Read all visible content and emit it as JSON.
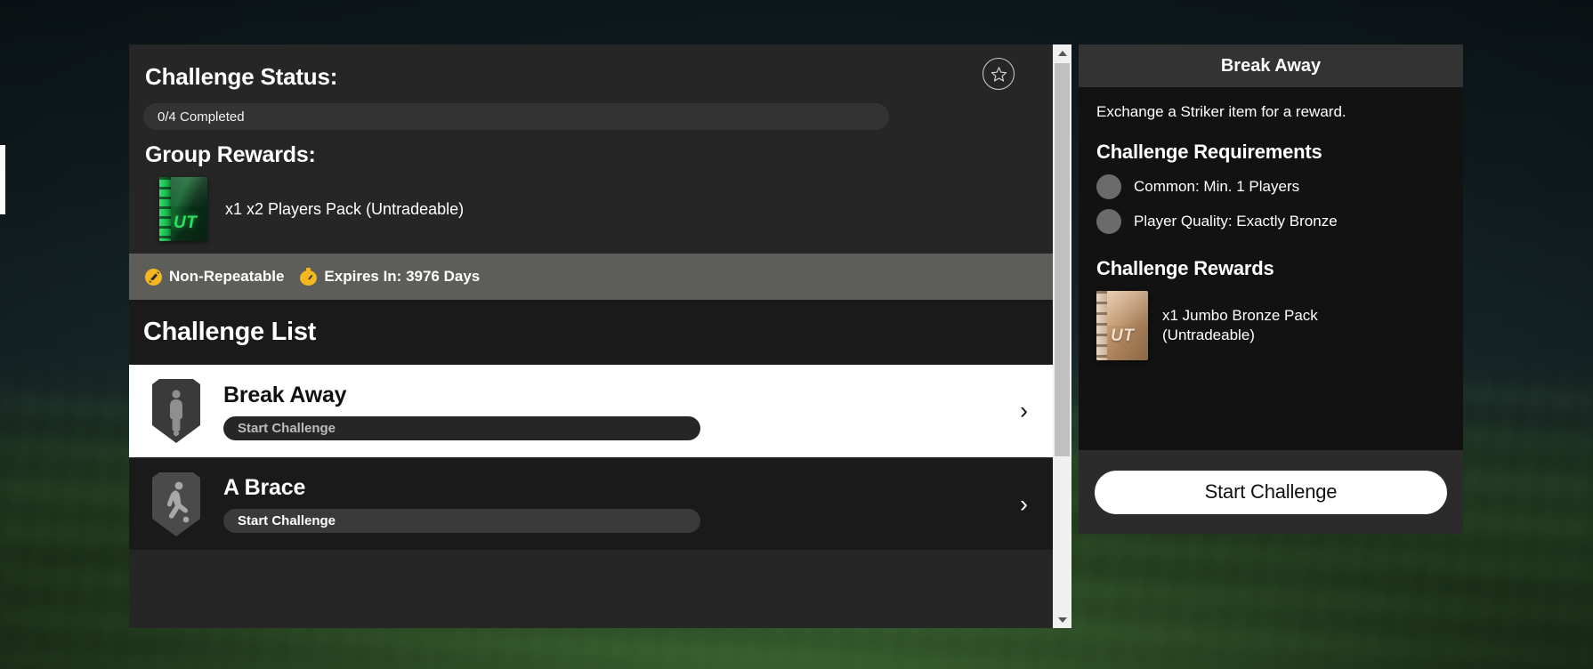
{
  "left_panel": {
    "status_title": "Challenge Status:",
    "status_value": "0/4 Completed",
    "group_rewards_title": "Group Rewards:",
    "group_reward": {
      "icon": "pack-green-ut-icon",
      "label": "x1 x2 Players Pack (Untradeable)",
      "pack_mark": "UT"
    },
    "meta": {
      "repeatable_icon": "no-repeat-icon",
      "repeatable_label": "Non-Repeatable",
      "timer_icon": "stopwatch-icon",
      "expiry_label": "Expires In: 3976 Days"
    },
    "favorite_icon": "star-icon",
    "list_title": "Challenge List",
    "challenges": [
      {
        "name": "Break Away",
        "button_label": "Start Challenge",
        "badge_icon": "striker-shield-badge-icon",
        "chevron_icon": "chevron-right-icon",
        "selected": true
      },
      {
        "name": "A Brace",
        "button_label": "Start Challenge",
        "badge_icon": "dribbler-shield-badge-icon",
        "chevron_icon": "chevron-right-icon",
        "selected": false
      }
    ]
  },
  "scrollbar": {
    "up_icon": "caret-up-icon",
    "down_icon": "caret-down-icon",
    "thumb": "scroll-thumb"
  },
  "right_panel": {
    "title": "Break Away",
    "description": "Exchange a Striker item for a reward.",
    "requirements_title": "Challenge Requirements",
    "requirements": [
      {
        "icon": "requirement-bullet-icon",
        "label": "Common: Min. 1 Players"
      },
      {
        "icon": "requirement-bullet-icon",
        "label": "Player Quality: Exactly Bronze"
      }
    ],
    "rewards_title": "Challenge Rewards",
    "reward": {
      "icon": "pack-bronze-ut-icon",
      "line1": "x1 Jumbo Bronze Pack",
      "line2": "(Untradeable)",
      "pack_mark": "UT"
    },
    "start_button": "Start Challenge"
  },
  "colors": {
    "accent_yellow": "#f5b720",
    "panel_dark": "#262626",
    "list_dark": "#1a1a1a",
    "selected_row": "#ffffff",
    "meta_strip": "#5d5d5a"
  }
}
